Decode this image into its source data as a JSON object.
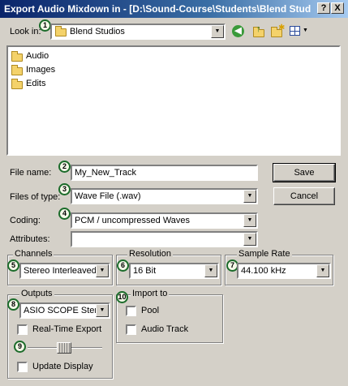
{
  "window": {
    "title": "Export Audio Mixdown in - [D:\\Sound-Course\\Students\\Blend Stud...",
    "help_label": "?",
    "close_label": "X"
  },
  "lookin": {
    "label": "Look in:",
    "value": "Blend Studios",
    "badge": "1"
  },
  "toolbar": {
    "icons": [
      "back-icon",
      "up-folder-icon",
      "new-folder-icon",
      "view-menu-icon"
    ]
  },
  "files": [
    {
      "name": "Audio",
      "icon": "folder-icon"
    },
    {
      "name": "Images",
      "icon": "folder-icon"
    },
    {
      "name": "Edits",
      "icon": "folder-icon"
    }
  ],
  "filename": {
    "label": "File name:",
    "value": "My_New_Track",
    "badge": "2"
  },
  "filetype": {
    "label": "Files of type:",
    "value": "Wave File (.wav)",
    "badge": "3"
  },
  "coding": {
    "label": "Coding:",
    "value": "PCM / uncompressed Waves",
    "badge": "4"
  },
  "attributes": {
    "label": "Attributes:",
    "value": ""
  },
  "buttons": {
    "save": "Save",
    "cancel": "Cancel"
  },
  "channels": {
    "title": "Channels",
    "value": "Stereo Interleaved",
    "badge": "5"
  },
  "resolution": {
    "title": "Resolution",
    "value": "16 Bit",
    "badge": "6"
  },
  "samplerate": {
    "title": "Sample Rate",
    "value": "44.100 kHz",
    "badge": "7"
  },
  "outputs": {
    "title": "Outputs",
    "value": "ASIO SCOPE Stereo",
    "badge": "8",
    "realtime_label": "Real-Time Export",
    "realtime_checked": false,
    "slider_badge": "9",
    "slider_level": 0.5,
    "update_label": "Update Display",
    "update_checked": false
  },
  "importto": {
    "title": "Import to",
    "badge": "10",
    "pool_label": "Pool",
    "pool_checked": false,
    "audiotrack_label": "Audio Track",
    "audiotrack_checked": false
  },
  "colors": {
    "title_bar_start": "#0a246a",
    "title_bar_end": "#a6caf0",
    "face": "#d4d0c8",
    "badge_border": "#1b6b2a"
  }
}
